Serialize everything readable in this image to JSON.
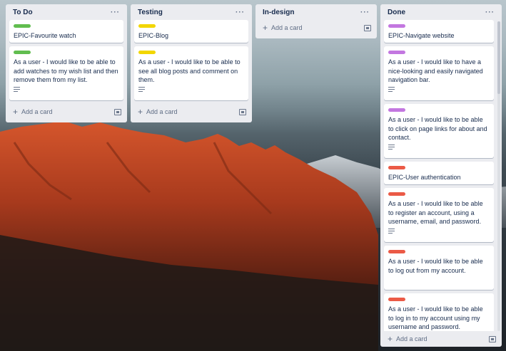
{
  "colors": {
    "green": "#61bd4f",
    "yellow": "#f2d600",
    "purple": "#c377e0",
    "red": "#eb5a46"
  },
  "lists": [
    {
      "title": "To Do",
      "cards": [
        {
          "label_color": "green",
          "text": "EPIC-Favourite watch",
          "has_description": false
        },
        {
          "label_color": "green",
          "text": "As a user - I would like to be able to add watches to my wish list and then remove them from my list.",
          "has_description": true
        }
      ],
      "add_card": "Add a card"
    },
    {
      "title": "Testing",
      "cards": [
        {
          "label_color": "yellow",
          "text": "EPIC-Blog",
          "has_description": false
        },
        {
          "label_color": "yellow",
          "text": "As a user - I would like to be able to see all blog posts and comment on them.",
          "has_description": true
        }
      ],
      "add_card": "Add a card"
    },
    {
      "title": "In-design",
      "cards": [],
      "add_card": "Add a card"
    },
    {
      "title": "Done",
      "cards": [
        {
          "label_color": "purple",
          "text": "EPIC-Navigate website",
          "has_description": false
        },
        {
          "label_color": "purple",
          "text": "As a user - I would like to have a nice-looking and easily navigated navigation bar.",
          "has_description": true
        },
        {
          "label_color": "purple",
          "text": "As a user - I would like to be able to click on page links for about and contact.",
          "has_description": true
        },
        {
          "label_color": "red",
          "text": "EPIC-User authentication",
          "has_description": false
        },
        {
          "label_color": "red",
          "text": "As a user - I would like to be able to register an account, using a username, email, and password.",
          "has_description": true
        },
        {
          "label_color": "red",
          "text": "As a user - I would like to be able to log out from my account.",
          "has_description": true
        },
        {
          "label_color": "red",
          "text": "As a user - I would like to be able to log in to my account using my username and password.",
          "has_description": false
        }
      ],
      "add_card": "Add a card"
    }
  ],
  "menu_icon": "ellipsis-icon",
  "description_icon": "description-lines-icon",
  "template_icon": "card-template-icon"
}
